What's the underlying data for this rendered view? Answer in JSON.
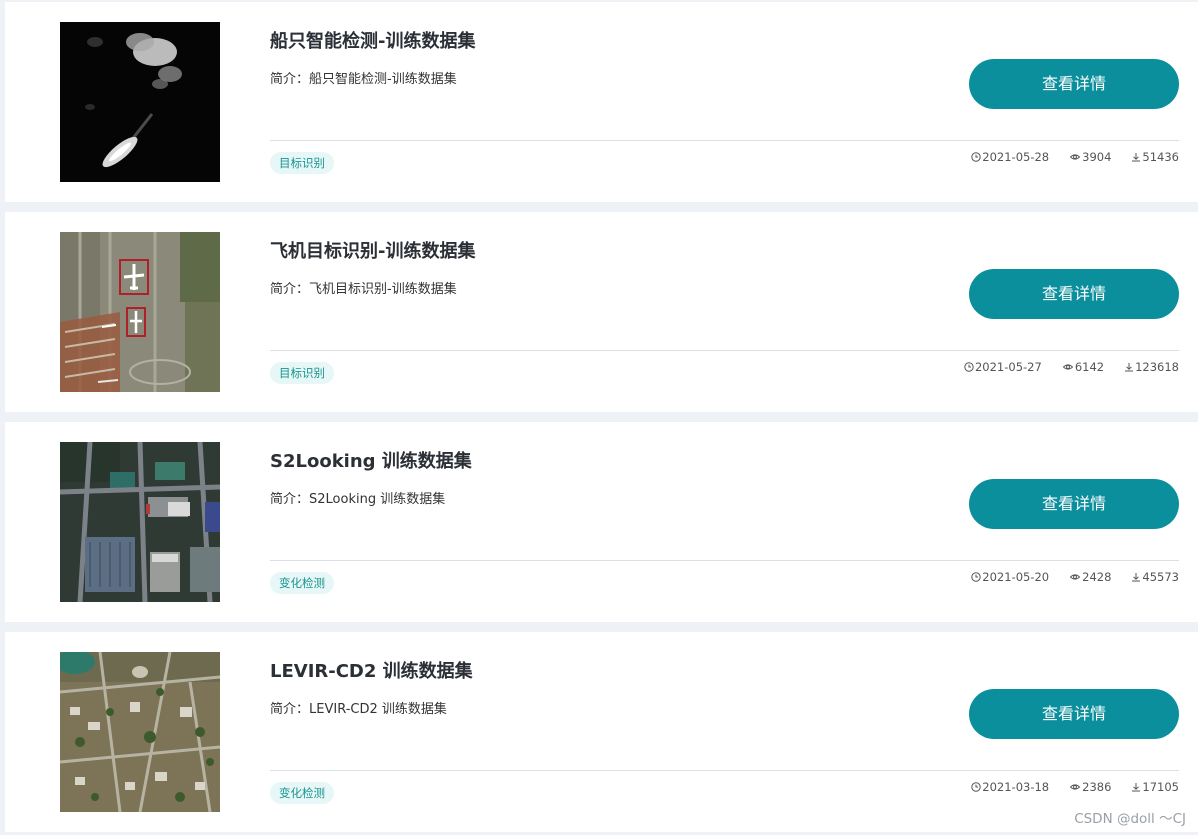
{
  "datasets": [
    {
      "title": "船只智能检测-训练数据集",
      "intro_prefix": "简介：",
      "intro": "船只智能检测-训练数据集",
      "button_label": "查看详情",
      "tag": "目标识别",
      "date": "2021-05-28",
      "views": "3904",
      "downloads": "51436"
    },
    {
      "title": "飞机目标识别-训练数据集",
      "intro_prefix": "简介：",
      "intro": "飞机目标识别-训练数据集",
      "button_label": "查看详情",
      "tag": "目标识别",
      "date": "2021-05-27",
      "views": "6142",
      "downloads": "123618"
    },
    {
      "title": "S2Looking 训练数据集",
      "intro_prefix": "简介：",
      "intro": "S2Looking 训练数据集",
      "button_label": "查看详情",
      "tag": "变化检测",
      "date": "2021-05-20",
      "views": "2428",
      "downloads": "45573"
    },
    {
      "title": "LEVIR-CD2 训练数据集",
      "intro_prefix": "简介：",
      "intro": "LEVIR-CD2 训练数据集",
      "button_label": "查看详情",
      "tag": "变化检测",
      "date": "2021-03-18",
      "views": "2386",
      "downloads": "17105"
    }
  ],
  "icons": {
    "date": "clock-icon",
    "views": "eye-icon",
    "downloads": "download-icon"
  },
  "colors": {
    "accent": "#0b8f9c",
    "tag_bg": "#e7f6f6",
    "tag_text": "#17958f",
    "page_bg": "#eef2f6"
  },
  "watermark": "CSDN @doll ～CJ"
}
